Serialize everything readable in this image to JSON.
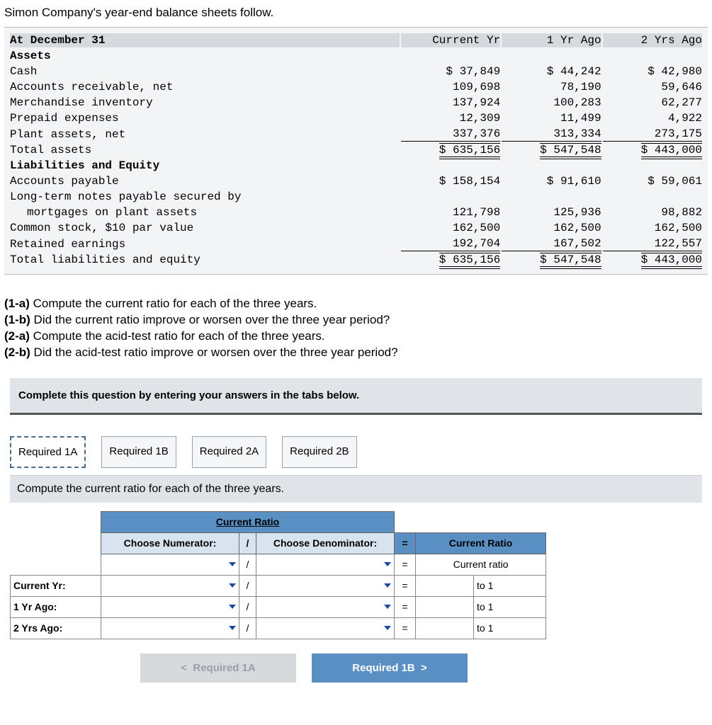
{
  "intro": "Simon Company's year-end balance sheets follow.",
  "headers": {
    "date": "At December 31",
    "cur": "Current Yr",
    "y1": "1 Yr Ago",
    "y2": "2 Yrs Ago"
  },
  "sections": {
    "assets": "Assets",
    "liab": "Liabilities and Equity"
  },
  "rows": {
    "cash": {
      "l": "Cash",
      "a": "$ 37,849",
      "b": "$ 44,242",
      "c": "$ 42,980"
    },
    "ar": {
      "l": "Accounts receivable, net",
      "a": "109,698",
      "b": "78,190",
      "c": "59,646"
    },
    "inv": {
      "l": "Merchandise inventory",
      "a": "137,924",
      "b": "100,283",
      "c": "62,277"
    },
    "pre": {
      "l": "Prepaid expenses",
      "a": "12,309",
      "b": "11,499",
      "c": "4,922"
    },
    "plant": {
      "l": "Plant assets, net",
      "a": "337,376",
      "b": "313,334",
      "c": "273,175"
    },
    "ta": {
      "l": "Total assets",
      "a": "$ 635,156",
      "b": "$ 547,548",
      "c": "$ 443,000"
    },
    "ap": {
      "l": "Accounts payable",
      "a": "$ 158,154",
      "b": "$ 91,610",
      "c": "$ 59,061"
    },
    "ltn1": {
      "l": "Long-term notes payable secured by"
    },
    "ltn2": {
      "l": "mortgages on plant assets",
      "a": "121,798",
      "b": "125,936",
      "c": "98,882"
    },
    "cs": {
      "l": "Common stock, $10 par value",
      "a": "162,500",
      "b": "162,500",
      "c": "162,500"
    },
    "re": {
      "l": "Retained earnings",
      "a": "192,704",
      "b": "167,502",
      "c": "122,557"
    },
    "tle": {
      "l": "Total liabilities and equity",
      "a": "$ 635,156",
      "b": "$ 547,548",
      "c": "$ 443,000"
    }
  },
  "questions": {
    "q1a": {
      "k": "(1-a)",
      "t": " Compute the current ratio for each of the three years."
    },
    "q1b": {
      "k": "(1-b)",
      "t": " Did the current ratio improve or worsen over the three year period?"
    },
    "q2a": {
      "k": "(2-a)",
      "t": " Compute the acid-test ratio for each of the three years."
    },
    "q2b": {
      "k": "(2-b)",
      "t": " Did the acid-test ratio improve or worsen over the three year period?"
    }
  },
  "prompt": "Complete this question by entering your answers in the tabs below.",
  "tabs": {
    "t1": "Required 1A",
    "t2": "Required 1B",
    "t3": "Required 2A",
    "t4": "Required 2B"
  },
  "subprompt": "Compute the current ratio for each of the three years.",
  "ratio": {
    "title": "Current Ratio",
    "numHdr": "Choose Numerator:",
    "denHdr": "Choose Denominator:",
    "slash": "/",
    "eq": "=",
    "resHdr": "Current Ratio",
    "resLbl": "Current ratio",
    "rows": {
      "r0": "",
      "r1": "Current Yr:",
      "r2": "1 Yr Ago:",
      "r3": "2 Yrs Ago:"
    },
    "to1": "to 1"
  },
  "nav": {
    "prev": "Required 1A",
    "prevIcon": "<",
    "next": "Required 1B",
    "nextIcon": ">"
  }
}
